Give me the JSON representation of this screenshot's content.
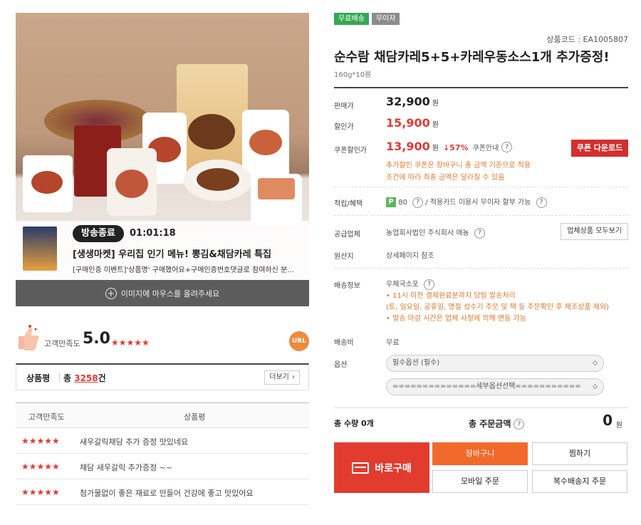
{
  "image": {
    "live_badge": "방송종료",
    "live_timer": "01:01:18",
    "live_title": "[생생마켓] 우리집 인기 메뉴! 뽕김&채담카레 특집",
    "live_sub": "[구매인증 이벤트]'상품명' 구매했어요+구매인증번호댓글로 참여하신 분...",
    "hint": "이미지에 마우스를 올려주세요"
  },
  "rating": {
    "label": "고객만족도",
    "score": "5.0",
    "stars": "★★★★★",
    "url": "URL"
  },
  "review_head": {
    "title": "상품평",
    "total_prefix": "총",
    "count": "3258",
    "suffix": "건",
    "more": "더보기"
  },
  "review_table": {
    "col1": "고객만족도",
    "col2": "상품평",
    "rows": [
      {
        "stars": "★★★★★",
        "text": "새우갈릭채담 추가 증정 맛있네요"
      },
      {
        "stars": "★★★★★",
        "text": "채담 새우갈릭 추가증정 ~~"
      },
      {
        "stars": "★★★★★",
        "text": "첨가물없이 좋은 재료로 만들어 건강에 좋고 맛있어요"
      }
    ]
  },
  "badges": {
    "free": "무료배송",
    "nointerest": "무이자"
  },
  "code": "상품코드 : EA1005807",
  "title": "순수람 채담카레5+5+카레우동소스1개 추가증정!",
  "subtitle": "160g*10봉",
  "price": {
    "orig_label": "판매가",
    "orig": "32,900",
    "won": "원",
    "sale_label": "할인가",
    "sale": "15,900",
    "coupon_label": "쿠폰할인가",
    "coupon": "13,900",
    "pct": "↓57%",
    "coupon_info": "쿠폰안내",
    "coupon_btn": "쿠폰 다운로드",
    "note1": "추가할인 쿠폰은 장바구니 총 금액 기준으로 적용",
    "note2": "조건에 따라 최종 금액은 달라질 수 있음"
  },
  "benefit": {
    "label": "적립/혜택",
    "p": "P",
    "points": "80",
    "slash": "/",
    "card": "적용카드 이용시 무이자 할부 가능"
  },
  "seller": {
    "label": "공급업체",
    "name": "농업회사법인 주식회사 애농",
    "btn": "업체상품 모두보기"
  },
  "origin": {
    "label": "원산지",
    "value": "상세페이지 참조"
  },
  "shipping": {
    "label": "배송정보",
    "method": "우체국소포",
    "n1": "• 11시 이전 결제완료분까지 당일 발송처리",
    "n2": "(토, 일요일, 공휴일, 명절 성수기 주문 및 택 등 주문확인 후 제조상품 제외)",
    "n3": "• 발송 마감 시간은 업체 사정에 의해 변동 가능"
  },
  "fee": {
    "label": "배송비",
    "value": "무료"
  },
  "option": {
    "label": "옵션",
    "select1": "필수옵션 (필수)",
    "select2": "==============세부옵션선택==========="
  },
  "totals": {
    "qty": "총 수량 0개",
    "amount_label": "총 주문금액",
    "amount": "0",
    "won": "원"
  },
  "actions": {
    "buy": "바로구매",
    "cart": "장바구니",
    "wish": "찜하기",
    "mobile": "모바일 주문",
    "multi": "복수배송지 주문"
  }
}
